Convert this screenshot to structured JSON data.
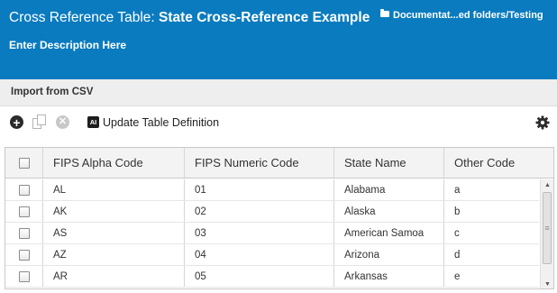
{
  "header": {
    "title_prefix": "Cross Reference Table: ",
    "title_name": "State Cross-Reference Example",
    "breadcrumb": "Documentat...ed folders/Testing",
    "description": "Enter Description Here",
    "background_color": "#0a7bbf"
  },
  "import": {
    "label": "Import from CSV"
  },
  "toolbar": {
    "add_icon": "plus-circle-icon",
    "copy_icon": "copy-icon",
    "remove_icon": "remove-circle-icon",
    "ai_badge": "AI",
    "update_label": "Update Table Definition",
    "settings_icon": "gear-icon"
  },
  "table": {
    "columns": [
      "FIPS Alpha Code",
      "FIPS Numeric Code",
      "State Name",
      "Other Code"
    ],
    "rows": [
      [
        "AL",
        "01",
        "Alabama",
        "a"
      ],
      [
        "AK",
        "02",
        "Alaska",
        "b"
      ],
      [
        "AS",
        "03",
        "American Samoa",
        "c"
      ],
      [
        "AZ",
        "04",
        "Arizona",
        "d"
      ],
      [
        "AR",
        "05",
        "Arkansas",
        "e"
      ]
    ]
  }
}
